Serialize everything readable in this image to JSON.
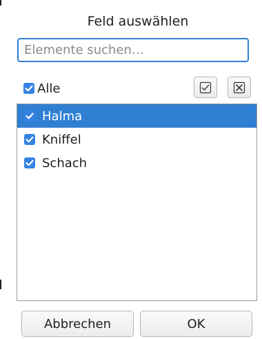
{
  "dialog": {
    "title": "Feld auswählen",
    "search": {
      "value": "",
      "placeholder": "Elemente suchen…"
    },
    "select_all": {
      "label": "Alle",
      "checked": true
    },
    "toolbar": {
      "check_icon": "checkbox-check-icon",
      "uncheck_icon": "checkbox-x-icon"
    },
    "items": [
      {
        "label": "Halma",
        "checked": true,
        "selected": true
      },
      {
        "label": "Kniffel",
        "checked": true,
        "selected": false
      },
      {
        "label": "Schach",
        "checked": true,
        "selected": false
      }
    ],
    "buttons": {
      "cancel": "Abbrechen",
      "ok": "OK"
    }
  },
  "colors": {
    "accent": "#3584e4",
    "selection": "#2f7fd3"
  }
}
